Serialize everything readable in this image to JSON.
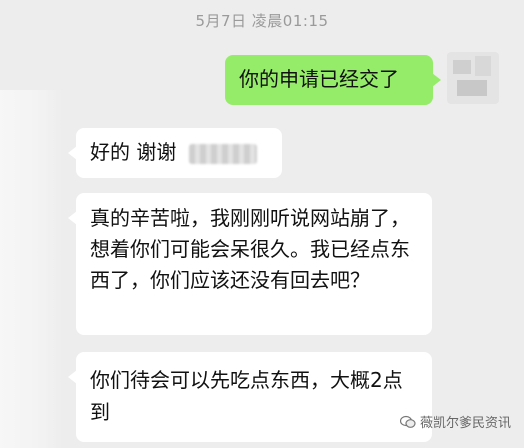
{
  "chat": {
    "timestamp": "5月7日 凌晨01:15",
    "messages": [
      {
        "direction": "out",
        "text": "你的申请已经交了"
      },
      {
        "direction": "in",
        "text": "好的 谢谢"
      },
      {
        "direction": "in",
        "text": "真的辛苦啦，我刚刚听说网站崩了，想着你们可能会呆很久。我已经点东西了，你们应该还没有回去吧？"
      },
      {
        "direction": "in",
        "text": "你们待会可以先吃点东西，大概2点到"
      }
    ]
  },
  "watermark": {
    "text": "薇凯尔爹民资讯",
    "icon": "wechat-icon"
  },
  "colors": {
    "background": "#ededed",
    "outgoing_bubble": "#95ec69",
    "incoming_bubble": "#ffffff"
  }
}
